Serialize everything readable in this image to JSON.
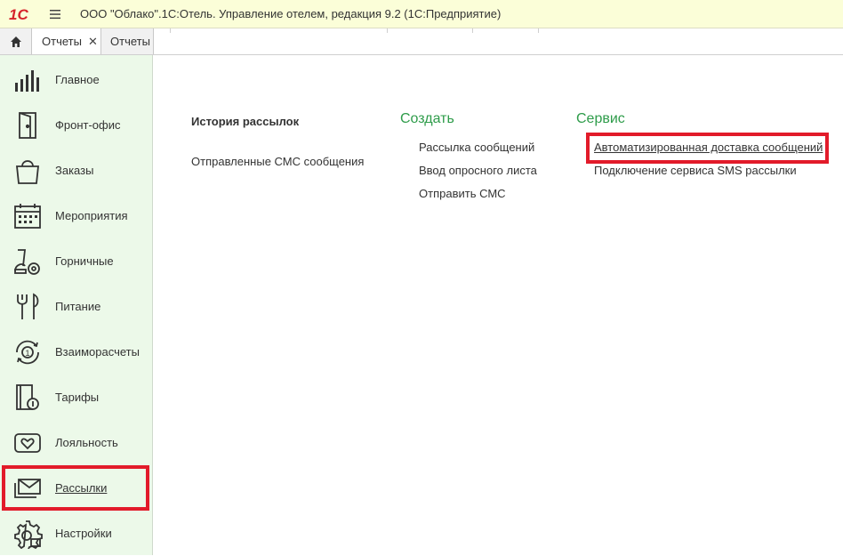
{
  "app": {
    "logo_text": "1С",
    "title": "ООО \"Облако\".1С:Отель. Управление отелем, редакция 9.2  (1С:Предприятие)"
  },
  "tabs": [
    {
      "label": "Отчеты",
      "closable": true,
      "active": true
    },
    {
      "label": "Отчеты",
      "closable": false,
      "active": false
    }
  ],
  "tab_close_glyph": "✕",
  "sidebar": {
    "items": [
      {
        "label": "Главное",
        "icon": "bar-chart-icon"
      },
      {
        "label": "Фронт-офис",
        "icon": "door-icon"
      },
      {
        "label": "Заказы",
        "icon": "shopping-bag-icon"
      },
      {
        "label": "Мероприятия",
        "icon": "calendar-icon"
      },
      {
        "label": "Горничные",
        "icon": "vacuum-cleaner-icon"
      },
      {
        "label": "Питание",
        "icon": "fork-knife-icon"
      },
      {
        "label": "Взаиморасчеты",
        "icon": "money-cycle-icon"
      },
      {
        "label": "Тарифы",
        "icon": "price-list-icon"
      },
      {
        "label": "Лояльность",
        "icon": "heart-card-icon"
      },
      {
        "label": "Рассылки",
        "icon": "envelope-icon",
        "active": true
      },
      {
        "label": "Настройки",
        "icon": "gear-icon"
      }
    ]
  },
  "main": {
    "col1": {
      "header": "История рассылок",
      "links": [
        "Отправленные СМС сообщения"
      ]
    },
    "col2": {
      "header": "Создать",
      "links": [
        "Рассылка сообщений",
        "Ввод опросного листа",
        "Отправить СМС"
      ]
    },
    "col3": {
      "header": "Сервис",
      "links": [
        "Автоматизированная доставка сообщений",
        "Подключение сервиса SMS рассылки"
      ]
    }
  },
  "colors": {
    "accent_green": "#2e9c4a",
    "highlight_red": "#e21b2a",
    "sidebar_bg": "#ecf9e9",
    "titlebar_bg": "#fbfed8"
  }
}
